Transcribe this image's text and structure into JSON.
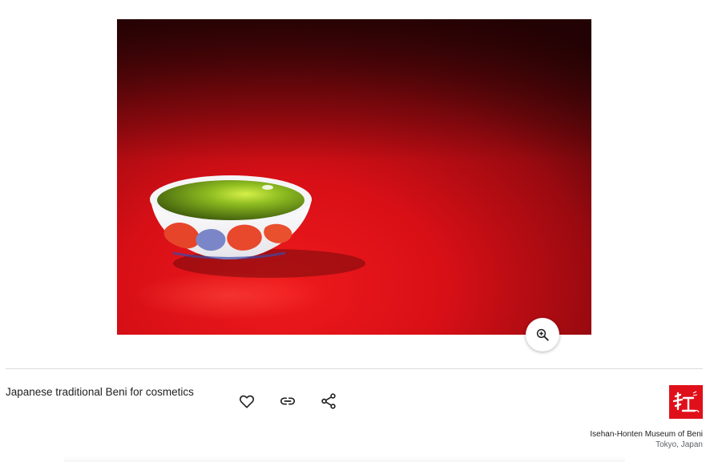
{
  "artwork": {
    "title": "Japanese traditional Beni for cosmetics",
    "image_description_icon": "lacquered-cup-image"
  },
  "actions": {
    "zoom_icon": "zoom-in-icon",
    "favorite_icon": "heart-icon",
    "link_icon": "link-icon",
    "share_icon": "share-icon"
  },
  "partner": {
    "name": "Isehan-Honten Museum of Beni",
    "location": "Tokyo, Japan",
    "logo_icon": "partner-logo-icon"
  },
  "colors": {
    "background_red": "#d0101a",
    "cup_glaze": "#6fa21a",
    "divider": "#dadce0"
  }
}
